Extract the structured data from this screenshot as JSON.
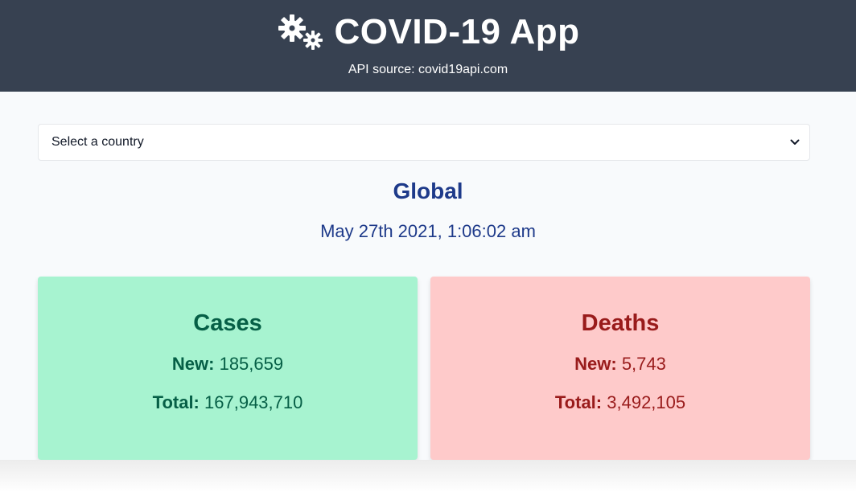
{
  "header": {
    "title": "COVID-19 App",
    "api_source": "API source: covid19api.com",
    "icon": "virus-gears-icon"
  },
  "country_select": {
    "selected": "Select a country"
  },
  "summary": {
    "region": "Global",
    "datetime": "May 27th 2021, 1:06:02 am"
  },
  "cards": {
    "cases": {
      "title": "Cases",
      "new_label": "New:",
      "new_value": "185,659",
      "total_label": "Total:",
      "total_value": "167,943,710"
    },
    "deaths": {
      "title": "Deaths",
      "new_label": "New:",
      "new_value": "5,743",
      "total_label": "Total:",
      "total_value": "3,492,105"
    }
  },
  "colors": {
    "header_bg": "#374151",
    "page_bg": "#f8fafc",
    "heading_blue": "#1e3a8a",
    "cases_bg": "#a7f3d0",
    "cases_text": "#065f46",
    "deaths_bg": "#fecaca",
    "deaths_text": "#991b1b"
  }
}
